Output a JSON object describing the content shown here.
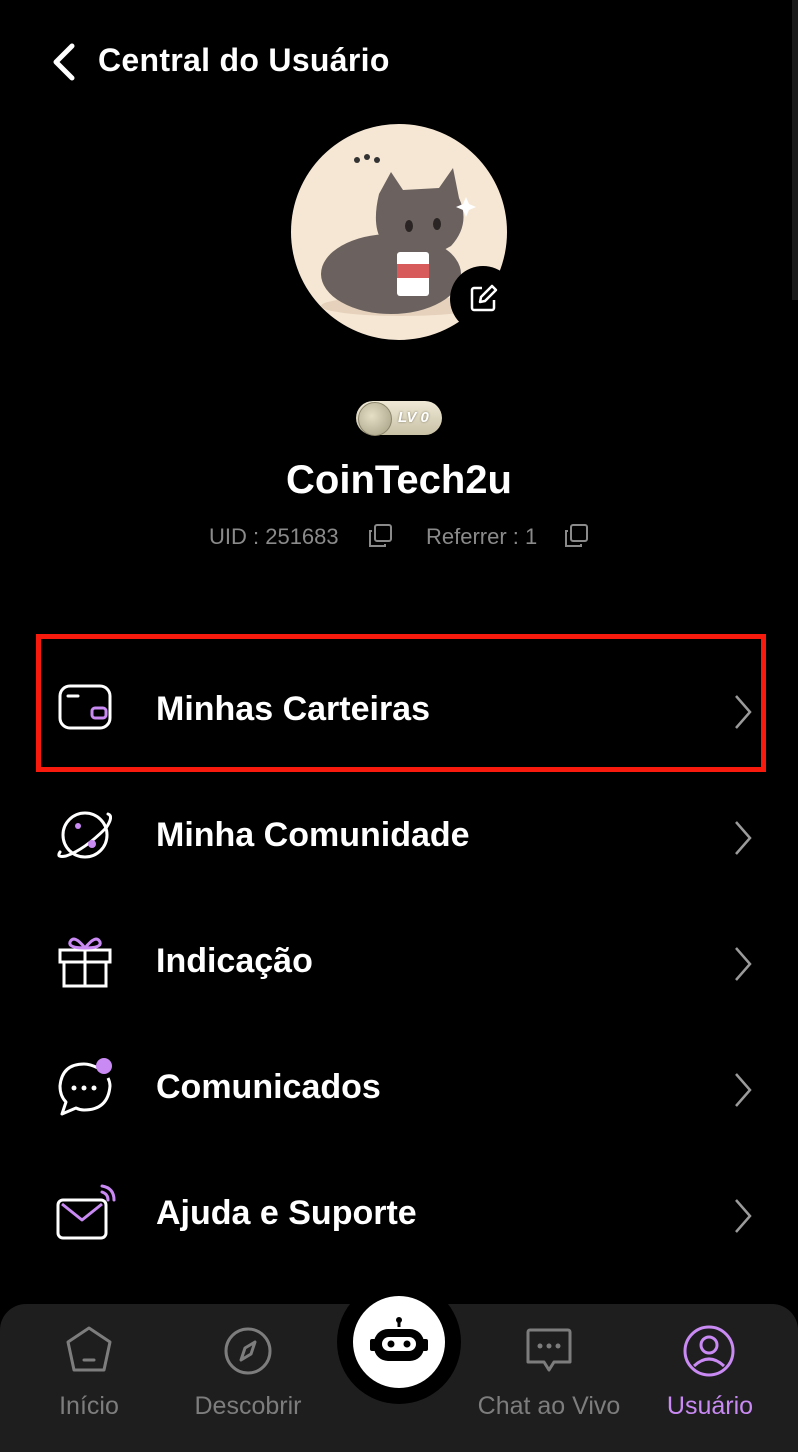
{
  "header": {
    "title": "Central do Usuário"
  },
  "profile": {
    "level": "LV 0",
    "username": "CoinTech2u",
    "uid_text": "UID : 251683",
    "referrer_text": "Referrer : 1"
  },
  "menu": [
    {
      "label": "Minhas Carteiras",
      "icon": "wallet-icon"
    },
    {
      "label": "Minha Comunidade",
      "icon": "planet-icon"
    },
    {
      "label": "Indicação",
      "icon": "gift-icon"
    },
    {
      "label": "Comunicados",
      "icon": "chat-bubble-icon"
    },
    {
      "label": "Ajuda e Suporte",
      "icon": "mail-icon"
    }
  ],
  "nav": {
    "home": "Início",
    "discover": "Descobrir",
    "chat": "Chat ao Vivo",
    "user": "Usuário"
  },
  "colors": {
    "background": "#000000",
    "accent": "#c98af3",
    "highlight_border": "#f71a0d",
    "nav_bg": "#1e1e1e"
  }
}
